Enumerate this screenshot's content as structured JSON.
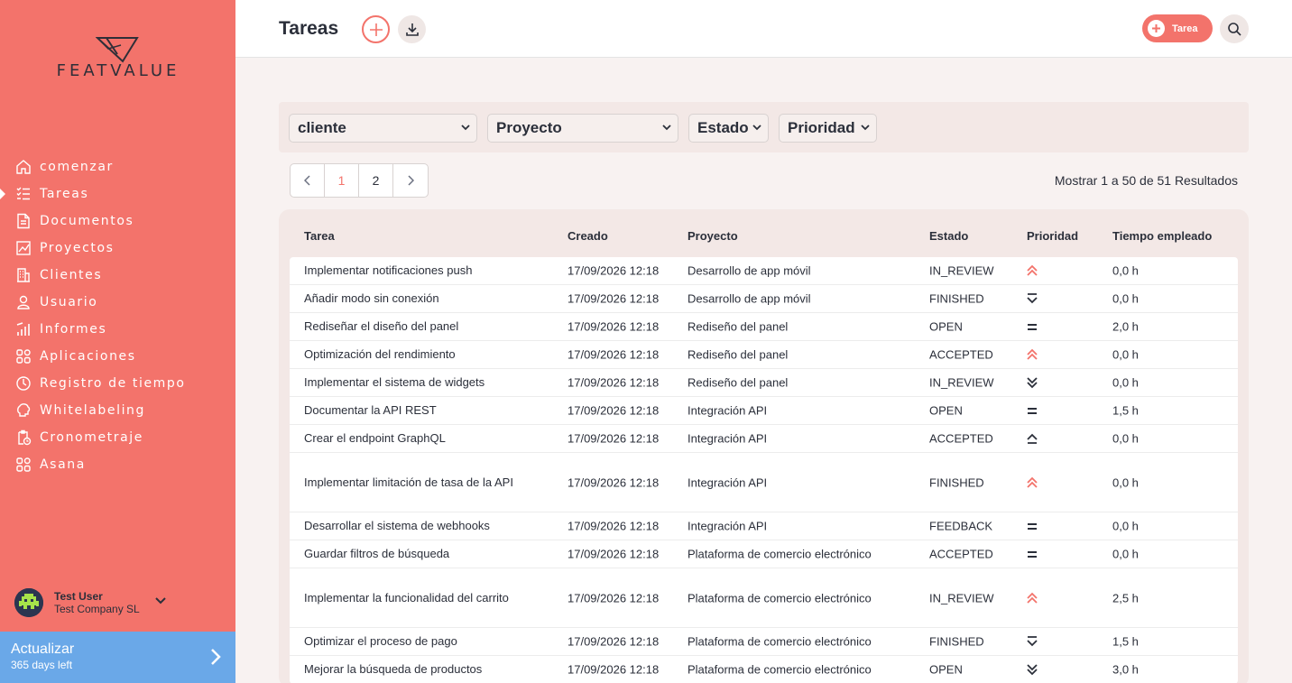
{
  "sidebar": {
    "logo_text": "FEATVALUE",
    "items": [
      {
        "label": "comenzar",
        "icon": "home-icon"
      },
      {
        "label": "Tareas",
        "icon": "task-list-icon",
        "active": true
      },
      {
        "label": "Documentos",
        "icon": "document-icon"
      },
      {
        "label": "Proyectos",
        "icon": "chart-icon"
      },
      {
        "label": "Clientes",
        "icon": "building-icon"
      },
      {
        "label": "Usuario",
        "icon": "user-icon"
      },
      {
        "label": "Informes",
        "icon": "bar-chart-icon"
      },
      {
        "label": "Aplicaciones",
        "icon": "apps-icon"
      },
      {
        "label": "Registro de tiempo",
        "icon": "timer-icon"
      },
      {
        "label": "Whitelabeling",
        "icon": "brain-icon"
      },
      {
        "label": "Cronometraje",
        "icon": "clipboard-clock-icon"
      },
      {
        "label": "Asana",
        "icon": "apps-icon"
      }
    ],
    "user": {
      "name": "Test User",
      "company": "Test Company SL"
    },
    "upgrade": {
      "title": "Actualizar",
      "subtitle": "365 days left"
    }
  },
  "header": {
    "title": "Tareas",
    "new_task_label": "Tarea"
  },
  "filters": {
    "client": "cliente",
    "project": "Proyecto",
    "status": "Estado",
    "priority": "Prioridad"
  },
  "pagination": {
    "pages": [
      "1",
      "2"
    ],
    "current": "1",
    "results_text": "Mostrar 1 a 50 de 51 Resultados"
  },
  "table": {
    "columns": [
      "Tarea",
      "Creado",
      "Proyecto",
      "Estado",
      "Prioridad",
      "Tiempo empleado"
    ],
    "rows": [
      {
        "task": "Implementar notificaciones push",
        "created": "17/09/2026 12:18",
        "project": "Desarrollo de app móvil",
        "status": "IN_REVIEW",
        "priority": "highest",
        "time": "0,0 h"
      },
      {
        "task": "Añadir modo sin conexión",
        "created": "17/09/2026 12:18",
        "project": "Desarrollo de app móvil",
        "status": "FINISHED",
        "priority": "lowest",
        "time": "0,0 h"
      },
      {
        "task": "Rediseñar el diseño del panel",
        "created": "17/09/2026 12:18",
        "project": "Rediseño del panel",
        "status": "OPEN",
        "priority": "medium",
        "time": "2,0 h"
      },
      {
        "task": "Optimización del rendimiento",
        "created": "17/09/2026 12:18",
        "project": "Rediseño del panel",
        "status": "ACCEPTED",
        "priority": "highest",
        "time": "0,0 h"
      },
      {
        "task": "Implementar el sistema de widgets",
        "created": "17/09/2026 12:18",
        "project": "Rediseño del panel",
        "status": "IN_REVIEW",
        "priority": "low",
        "time": "0,0 h"
      },
      {
        "task": "Documentar la API REST",
        "created": "17/09/2026 12:18",
        "project": "Integración API",
        "status": "OPEN",
        "priority": "medium",
        "time": "1,5 h"
      },
      {
        "task": "Crear el endpoint GraphQL",
        "created": "17/09/2026 12:18",
        "project": "Integración API",
        "status": "ACCEPTED",
        "priority": "high",
        "time": "0,0 h"
      },
      {
        "task": "Implementar limitación de tasa de la API",
        "created": "17/09/2026 12:18",
        "project": "Integración API",
        "status": "FINISHED",
        "priority": "highest",
        "time": "0,0 h"
      },
      {
        "task": "Desarrollar el sistema de webhooks",
        "created": "17/09/2026 12:18",
        "project": "Integración API",
        "status": "FEEDBACK",
        "priority": "medium",
        "time": "0,0 h"
      },
      {
        "task": "Guardar filtros de búsqueda",
        "created": "17/09/2026 12:18",
        "project": "Plataforma de comercio electrónico",
        "status": "ACCEPTED",
        "priority": "medium",
        "time": "0,0 h"
      },
      {
        "task": "Implementar la funcionalidad del carrito",
        "created": "17/09/2026 12:18",
        "project": "Plataforma de comercio electrónico",
        "status": "IN_REVIEW",
        "priority": "highest",
        "time": "2,5 h"
      },
      {
        "task": "Optimizar el proceso de pago",
        "created": "17/09/2026 12:18",
        "project": "Plataforma de comercio electrónico",
        "status": "FINISHED",
        "priority": "lowest",
        "time": "1,5 h"
      },
      {
        "task": "Mejorar la búsqueda de productos",
        "created": "17/09/2026 12:18",
        "project": "Plataforma de comercio electrónico",
        "status": "OPEN",
        "priority": "low",
        "time": "3,0 h"
      }
    ]
  },
  "colors": {
    "accent": "#f3736b",
    "upgrade": "#6aa8e8",
    "priority_high": "#f3736b",
    "priority_low": "#2b2f3a"
  }
}
